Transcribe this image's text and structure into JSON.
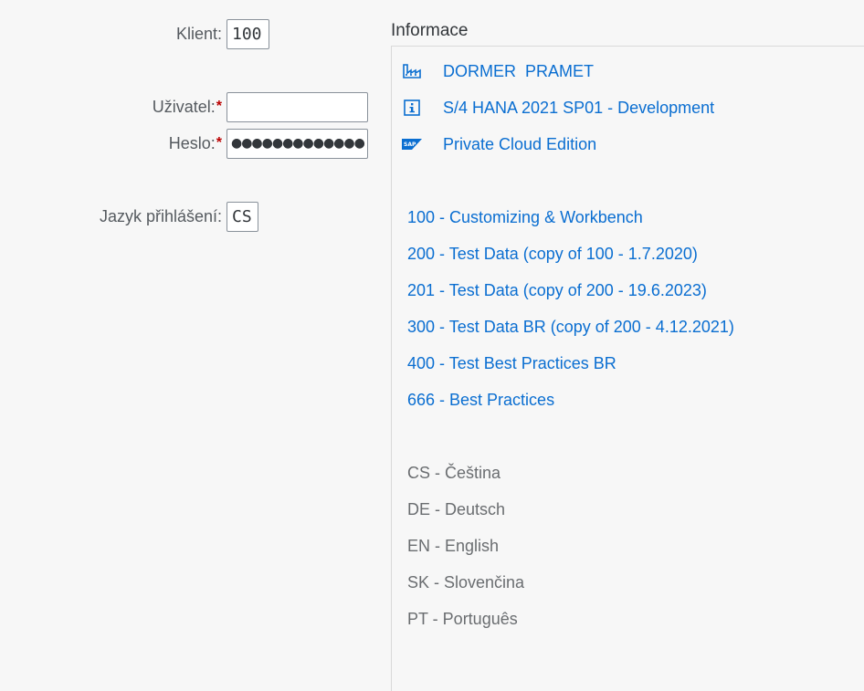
{
  "form": {
    "client_label": "Klient:",
    "client_value": "100",
    "user_label": "Uživatel:",
    "user_value": "",
    "password_label": "Heslo:",
    "password_value": "●●●●●●●●●●●●●",
    "language_label": "Jazyk přihlášení:",
    "language_value": "CS",
    "required_mark": "*"
  },
  "info": {
    "title": "Informace",
    "system_lines": [
      {
        "icon": "factory-icon",
        "text": "DORMER  PRAMET"
      },
      {
        "icon": "info-icon",
        "text": "S/4 HANA 2021 SP01 - Development"
      },
      {
        "icon": "sap-logo-icon",
        "text": "Private Cloud Edition"
      }
    ],
    "clients": [
      "100 - Customizing & Workbench",
      "200 - Test Data (copy of 100 - 1.7.2020)",
      "201 - Test Data (copy of 200 - 19.6.2023)",
      "300 - Test Data BR (copy of 200 - 4.12.2021)",
      "400 - Test Best Practices BR",
      "666 - Best Practices"
    ],
    "languages": [
      "CS - Čeština",
      "DE - Deutsch",
      "EN - English",
      "SK - Slovenčina",
      "PT - Português"
    ]
  },
  "colors": {
    "link": "#0a6ed1",
    "required": "#bb0000",
    "background": "#f7f7f7",
    "muted_text": "#6a6d70"
  }
}
